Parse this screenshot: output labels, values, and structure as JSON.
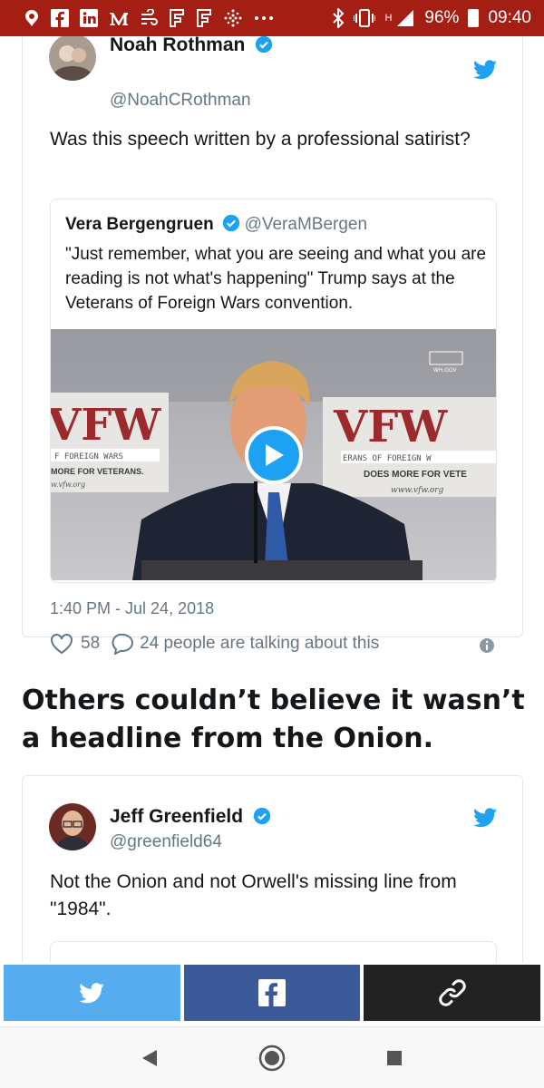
{
  "status_bar": {
    "left_icons": [
      "notification-icon",
      "facebook-icon",
      "linkedin-icon",
      "medium-icon",
      "wind-icon",
      "flipboard-icon",
      "flipboard-icon",
      "grid-dots-icon",
      "more-icon"
    ],
    "bluetooth": "bluetooth-icon",
    "vibrate": "vibrate-icon",
    "network": "H",
    "battery": "96%",
    "time": "09:40"
  },
  "tweet1": {
    "author_name": "Noah Rothman",
    "handle": "@NoahCRothman",
    "text": "Was this speech written by a professional satirist?",
    "quote": {
      "author_name": "Vera Bergengruen",
      "handle": "@VeraMBergen",
      "text": "\"Just remember, what you are seeing and what you are reading is not what's happening\" Trump says at the Veterans of Foreign Wars convention.",
      "video": {
        "sign_left_big": "VFW",
        "sign_left_small": "F FOREIGN WARS",
        "sign_left_more": "MORE FOR VETERANS.",
        "sign_left_url": "w.vfw.org",
        "sign_right_big": "VFW",
        "sign_right_small": "ERANS OF FOREIGN W",
        "sign_right_more": "DOES MORE FOR VETE",
        "sign_right_url": "www.vfw.org",
        "wh_label": "WH.GOV"
      }
    },
    "timestamp": "1:40 PM - Jul 24, 2018",
    "likes": "58",
    "talking": "24 people are talking about this"
  },
  "headline": "Others couldn’t believe it wasn’t a headline from the Onion.",
  "tweet2": {
    "author_name": "Jeff Greenfield",
    "handle": "@greenfield64",
    "text": "Not the Onion and not Orwell's missing line from \"1984\"."
  },
  "colors": {
    "status_bar": "#a51e14",
    "twitter_blue": "#1da1f2",
    "share_twitter": "#55acee",
    "share_facebook": "#3b5998",
    "share_link": "#222222"
  }
}
